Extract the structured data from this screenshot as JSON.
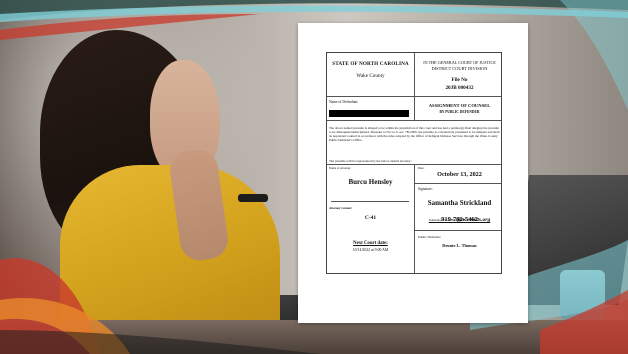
{
  "form": {
    "state": "STATE OF NORTH CAROLINA",
    "county": "Wake County",
    "court_line1": "IN THE GENERAL COURT OF JUSTICE",
    "court_line2": "DISTRICT COURT DIVISION",
    "file_no_label": "File No",
    "file_no": "20JB 000432",
    "defendant_label": "Name of Defendant:",
    "title_line1": "ASSIGNMENT OF COUNSEL",
    "title_line2": "BY PUBLIC DEFENDER",
    "paragraph": "The above named juvenile is alleged to be within the jurisdiction of this court and has had a petition(s) filed alleging the juvenile to be delinquent/undisciplined. Pursuant to N.C.G.S. sec. 7B-2000, the juvenile is conclusively presumed to be indigent and shall be appointed counsel in accordance with the rules adopted by the Office of Indigent Defense Services through the Wake County Public Defender's Office.",
    "represented_line": "The juvenile will be represented by the below named attorney:",
    "attorney_label": "Name of Attorney",
    "attorney_name": "Burcu Hensley",
    "attorney_contact_label": "Attorney Contact:",
    "attorney_contact": "C-41",
    "next_court_label": "Next Court date:",
    "next_court_value": "10/14/2022 at 9:00 AM",
    "date_label": "Date:",
    "date_value": "October 13, 2022",
    "signature_label": "Signature:",
    "signature_name": "Samantha Strickland",
    "signature_email_user": "Samantha.K.Strickland",
    "signature_email_domain": "@nccourts.org",
    "phone": "919-792-5462",
    "public_defender_label": "Public Defender:",
    "public_defender_name": "Deonte L. Thomas"
  },
  "colors": {
    "sweater": "#d9a824",
    "swoosh_teal": "#7fd0d8",
    "swoosh_red": "#c8392b",
    "swoosh_orange": "#e8892a"
  }
}
